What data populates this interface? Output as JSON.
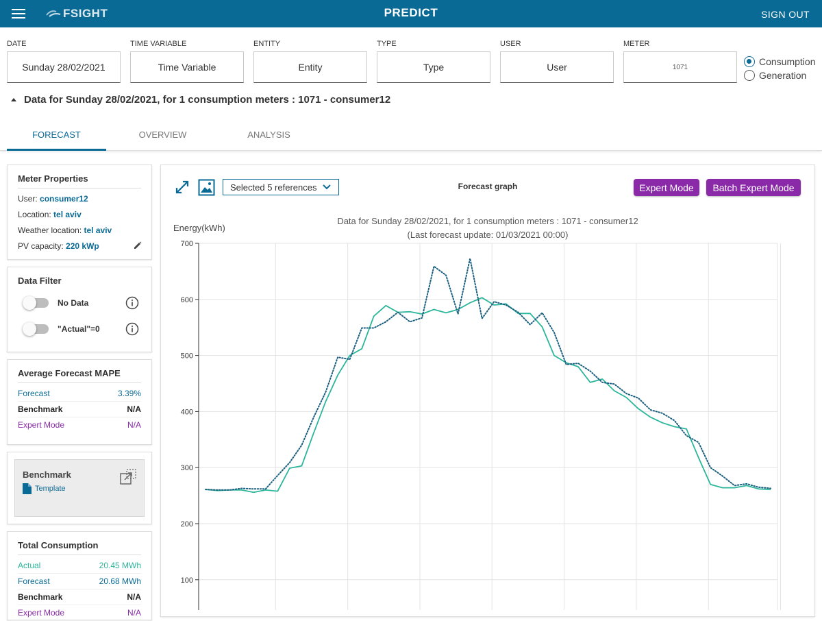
{
  "header": {
    "logo_text": "FSIGHT",
    "title": "PREDICT",
    "signout_label": "SIGN OUT"
  },
  "filters": [
    {
      "label": "DATE",
      "value": "Sunday 28/02/2021"
    },
    {
      "label": "TIME VARIABLE",
      "value": "Time Variable"
    },
    {
      "label": "ENTITY",
      "value": "Entity"
    },
    {
      "label": "TYPE",
      "value": "Type"
    },
    {
      "label": "USER",
      "value": "User"
    },
    {
      "label": "METER",
      "value": "1071"
    }
  ],
  "mode": {
    "options": [
      "Consumption",
      "Generation"
    ],
    "selected": "Consumption"
  },
  "summary": "Data for Sunday 28/02/2021, for 1 consumption meters : 1071 - consumer12",
  "tabs": [
    "FORECAST",
    "OVERVIEW",
    "ANALYSIS"
  ],
  "active_tab": "FORECAST",
  "meter_properties": {
    "title": "Meter Properties",
    "user_label": "User:",
    "user": "consumer12",
    "location_label": "Location:",
    "location": "tel aviv",
    "weather_label": "Weather location:",
    "weather": "tel aviv",
    "pv_label": "PV capacity:",
    "pv": "220 kWp"
  },
  "data_filter": {
    "title": "Data Filter",
    "no_data": "No Data",
    "actual_zero": "\"Actual\"=0"
  },
  "mape": {
    "title": "Average Forecast MAPE",
    "rows": [
      {
        "label": "Forecast",
        "value": "3.39%"
      },
      {
        "label": "Benchmark",
        "value": "N/A"
      },
      {
        "label": "Expert Mode",
        "value": "N/A"
      }
    ]
  },
  "benchmark": {
    "title": "Benchmark",
    "link": "Template"
  },
  "total": {
    "title": "Total Consumption",
    "rows": [
      {
        "label": "Actual",
        "value": "20.45 MWh"
      },
      {
        "label": "Forecast",
        "value": "20.68 MWh"
      },
      {
        "label": "Benchmark",
        "value": "N/A"
      },
      {
        "label": "Expert Mode",
        "value": "N/A"
      }
    ]
  },
  "graph_toolbar": {
    "refs_label": "Selected 5 references",
    "title": "Forecast graph",
    "expert_btn": "Expert Mode",
    "batch_btn": "Batch Expert Mode"
  },
  "colors": {
    "primary": "#0a6a96",
    "actual": "#2bb59a",
    "forecast": "#1a5f80",
    "expert": "#8a2aa8"
  },
  "chart_data": {
    "type": "line",
    "title": "Data for Sunday 28/02/2021, for 1  consumption meters : 1071 - consumer12",
    "subtitle": "(Last forecast update: 01/03/2021 00:00)",
    "ylabel": "Energy(kWh)",
    "ylim": [
      0,
      700
    ],
    "yticks": [
      100,
      200,
      300,
      400,
      500,
      600,
      700
    ],
    "grid": true,
    "x": [
      0,
      0.5,
      1,
      1.5,
      2,
      2.5,
      3,
      3.5,
      4,
      4.5,
      5,
      5.5,
      6,
      6.5,
      7,
      7.5,
      8,
      8.5,
      9,
      9.5,
      10,
      10.5,
      11,
      11.5,
      12,
      12.5,
      13,
      13.5,
      14,
      14.5,
      15,
      15.5,
      16,
      16.5,
      17,
      17.5,
      18,
      18.5,
      19,
      19.5,
      20,
      20.5,
      21,
      21.5,
      22,
      22.5,
      23,
      23.5
    ],
    "series": [
      {
        "style": "solid",
        "values": [
          261,
          259,
          260,
          260,
          256,
          260,
          258,
          299,
          303,
          362,
          418,
          465,
          500,
          512,
          570,
          589,
          577,
          578,
          574,
          582,
          576,
          582,
          594,
          603,
          590,
          592,
          575,
          575,
          551,
          500,
          487,
          480,
          452,
          458,
          437,
          425,
          405,
          390,
          380,
          373,
          369,
          318,
          270,
          264,
          264,
          268,
          262,
          261
        ]
      },
      {
        "style": "dotted",
        "values": [
          261,
          260,
          260,
          263,
          262,
          262,
          286,
          309,
          340,
          390,
          435,
          497,
          493,
          549,
          549,
          560,
          577,
          560,
          567,
          659,
          643,
          574,
          673,
          566,
          596,
          590,
          577,
          555,
          576,
          541,
          484,
          486,
          472,
          452,
          449,
          432,
          424,
          403,
          397,
          384,
          357,
          345,
          300,
          285,
          268,
          271,
          265,
          263
        ]
      }
    ]
  }
}
